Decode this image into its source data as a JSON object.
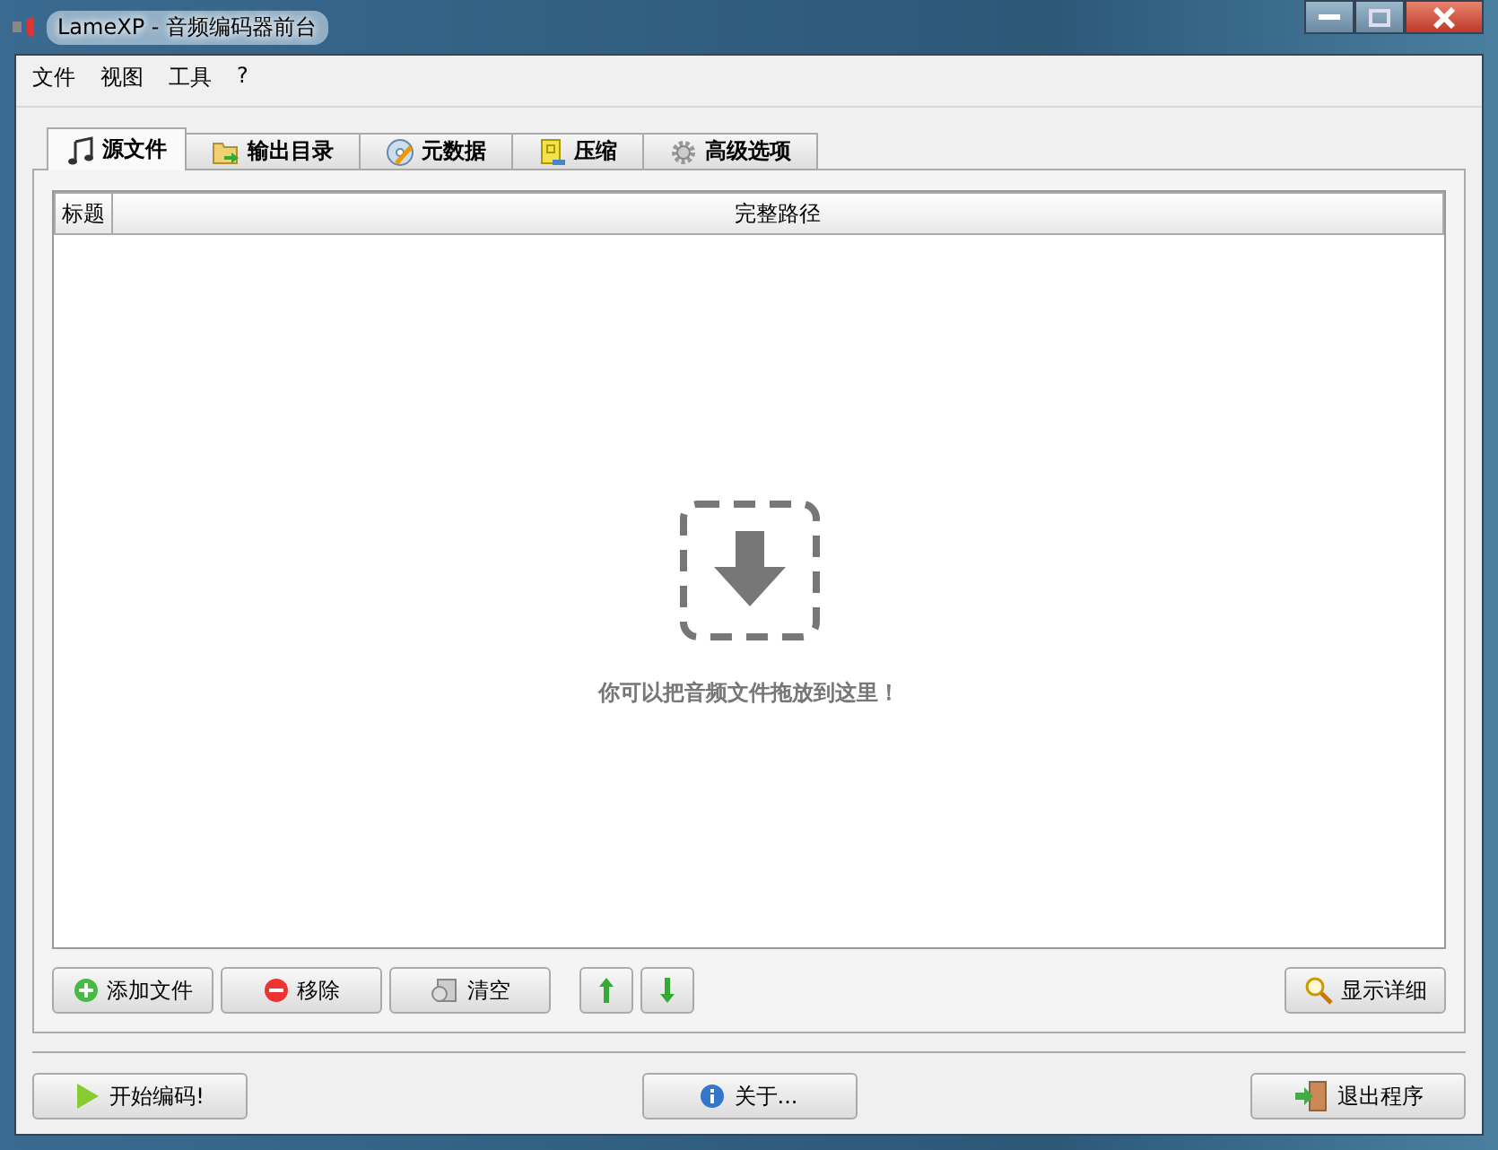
{
  "window": {
    "title": "LameXP - 音频编码器前台"
  },
  "menu": [
    "文件",
    "视图",
    "工具",
    "?"
  ],
  "tabs": [
    {
      "label": "源文件",
      "selected": true,
      "kind": "music"
    },
    {
      "label": "输出目录",
      "selected": false,
      "kind": "folder"
    },
    {
      "label": "元数据",
      "selected": false,
      "kind": "disc"
    },
    {
      "label": "压缩",
      "selected": false,
      "kind": "archive"
    },
    {
      "label": "高级选项",
      "selected": false,
      "kind": "gear"
    }
  ],
  "table": {
    "columns": [
      "标题",
      "完整路径"
    ]
  },
  "drop_hint": "你可以把音频文件拖放到这里！",
  "file_buttons": [
    {
      "label": "添加文件",
      "kind": "add"
    },
    {
      "label": "移除",
      "kind": "remove"
    },
    {
      "label": "清空",
      "kind": "clear"
    },
    {
      "kind": "up"
    },
    {
      "kind": "down"
    }
  ],
  "details_button": {
    "label": "显示详细"
  },
  "bottom_buttons": [
    {
      "label": "开始编码!",
      "kind": "start"
    },
    {
      "label": "关于...",
      "kind": "about"
    },
    {
      "label": "退出程序",
      "kind": "exit"
    }
  ]
}
